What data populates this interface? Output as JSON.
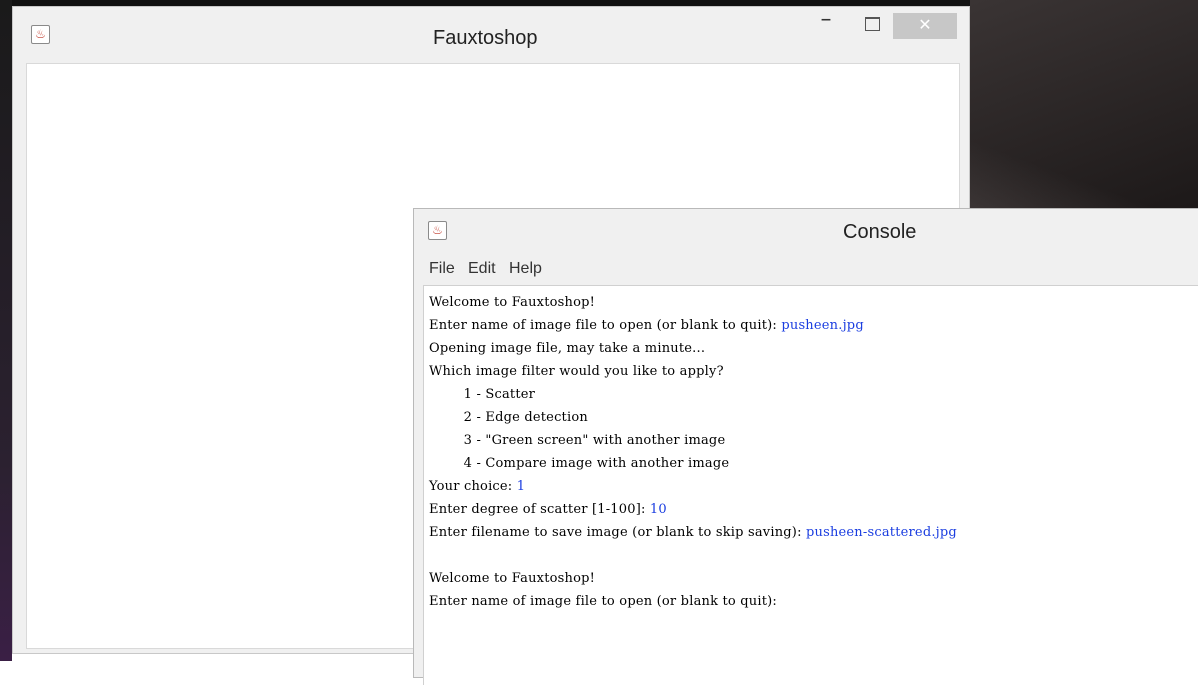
{
  "main_window": {
    "title": "Fauxtoshop",
    "minimize_glyph": "–",
    "close_glyph": "✕"
  },
  "console_window": {
    "title": "Console",
    "menu": [
      "File",
      "Edit",
      "Help"
    ],
    "lines": [
      {
        "text": "Welcome to Fauxtoshop!",
        "input": ""
      },
      {
        "text": "Enter name of image file to open (or blank to quit): ",
        "input": "pusheen.jpg"
      },
      {
        "text": "Opening image file, may take a minute...",
        "input": ""
      },
      {
        "text": "Which image filter would you like to apply?",
        "input": ""
      },
      {
        "text": "        1 - Scatter",
        "input": ""
      },
      {
        "text": "        2 - Edge detection",
        "input": ""
      },
      {
        "text": "        3 - \"Green screen\" with another image",
        "input": ""
      },
      {
        "text": "        4 - Compare image with another image",
        "input": ""
      },
      {
        "text": "Your choice: ",
        "input": "1"
      },
      {
        "text": "Enter degree of scatter [1-100]: ",
        "input": "10"
      },
      {
        "text": "Enter filename to save image (or blank to skip saving): ",
        "input": "pusheen-scattered.jpg"
      },
      {
        "text": "",
        "input": ""
      },
      {
        "text": "Welcome to Fauxtoshop!",
        "input": ""
      },
      {
        "text": "Enter name of image file to open (or blank to quit): ",
        "input": ""
      }
    ]
  },
  "colors": {
    "user_input": "#1a3de0",
    "window_chrome": "#f0f0f0",
    "close_button": "#c7c7c7"
  },
  "icons": {
    "app_icon": "java-coffee-icon"
  }
}
